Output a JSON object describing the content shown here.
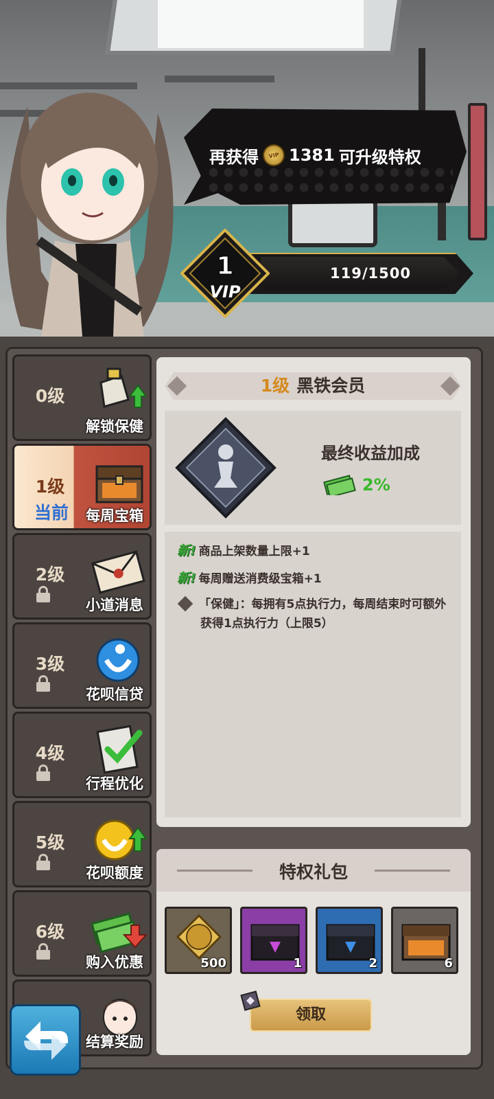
{
  "speech": {
    "prefix": "再获得",
    "coin_label": "VIP",
    "amount": "1381",
    "suffix": "可升级特权"
  },
  "vip": {
    "level": "1",
    "badge_text": "VIP",
    "progress_text": "119/1500",
    "progress_fraction": 0.0793
  },
  "sidebar": {
    "current_tag": "当前",
    "items": [
      {
        "level": "0级",
        "label": "解锁保健",
        "icon": "sneaker-upgrade-icon",
        "locked": false,
        "current": false
      },
      {
        "level": "1级",
        "label": "每周宝箱",
        "icon": "treasure-chest-icon",
        "locked": false,
        "current": true
      },
      {
        "level": "2级",
        "label": "小道消息",
        "icon": "envelope-icon",
        "locked": true,
        "current": false
      },
      {
        "level": "3级",
        "label": "花呗信贷",
        "icon": "huabei-icon",
        "locked": true,
        "current": false
      },
      {
        "level": "4级",
        "label": "行程优化",
        "icon": "clipboard-check-icon",
        "locked": true,
        "current": false
      },
      {
        "level": "5级",
        "label": "花呗额度",
        "icon": "huabei-upgrade-icon",
        "locked": true,
        "current": false
      },
      {
        "level": "6级",
        "label": "购入优惠",
        "icon": "cash-discount-icon",
        "locked": true,
        "current": false
      },
      {
        "level": "",
        "label": "结算奖励",
        "icon": "character-portrait-icon",
        "locked": false,
        "current": false
      }
    ]
  },
  "detail": {
    "level": "1级",
    "name": "黑铁会员",
    "bonus_title": "最终收益加成",
    "bonus_value": "2%",
    "new_tag": "新!",
    "perks": [
      {
        "new": true,
        "text": "商品上架数量上限+1"
      },
      {
        "new": true,
        "text": "每周赠送消费级宝箱+1"
      },
      {
        "new": false,
        "text": "「保健」：每拥有5点执行力，每周结束时可额外获得1点执行力（上限5）"
      }
    ]
  },
  "gift": {
    "title": "特权礼包",
    "items": [
      {
        "icon": "vip-coin-icon",
        "count": "500",
        "bg": "#6e6350"
      },
      {
        "icon": "purple-chest-icon",
        "count": "1",
        "bg": "#8b3fa6"
      },
      {
        "icon": "blue-chest-icon",
        "count": "2",
        "bg": "#2f6db3"
      },
      {
        "icon": "brown-chest-icon",
        "count": "6",
        "bg": "#6b6663"
      }
    ],
    "claim_label": "领取"
  },
  "colors": {
    "level_accent": "#d48a1e",
    "bonus_green": "#38b82c",
    "current_tag_blue": "#2f6fd1"
  }
}
